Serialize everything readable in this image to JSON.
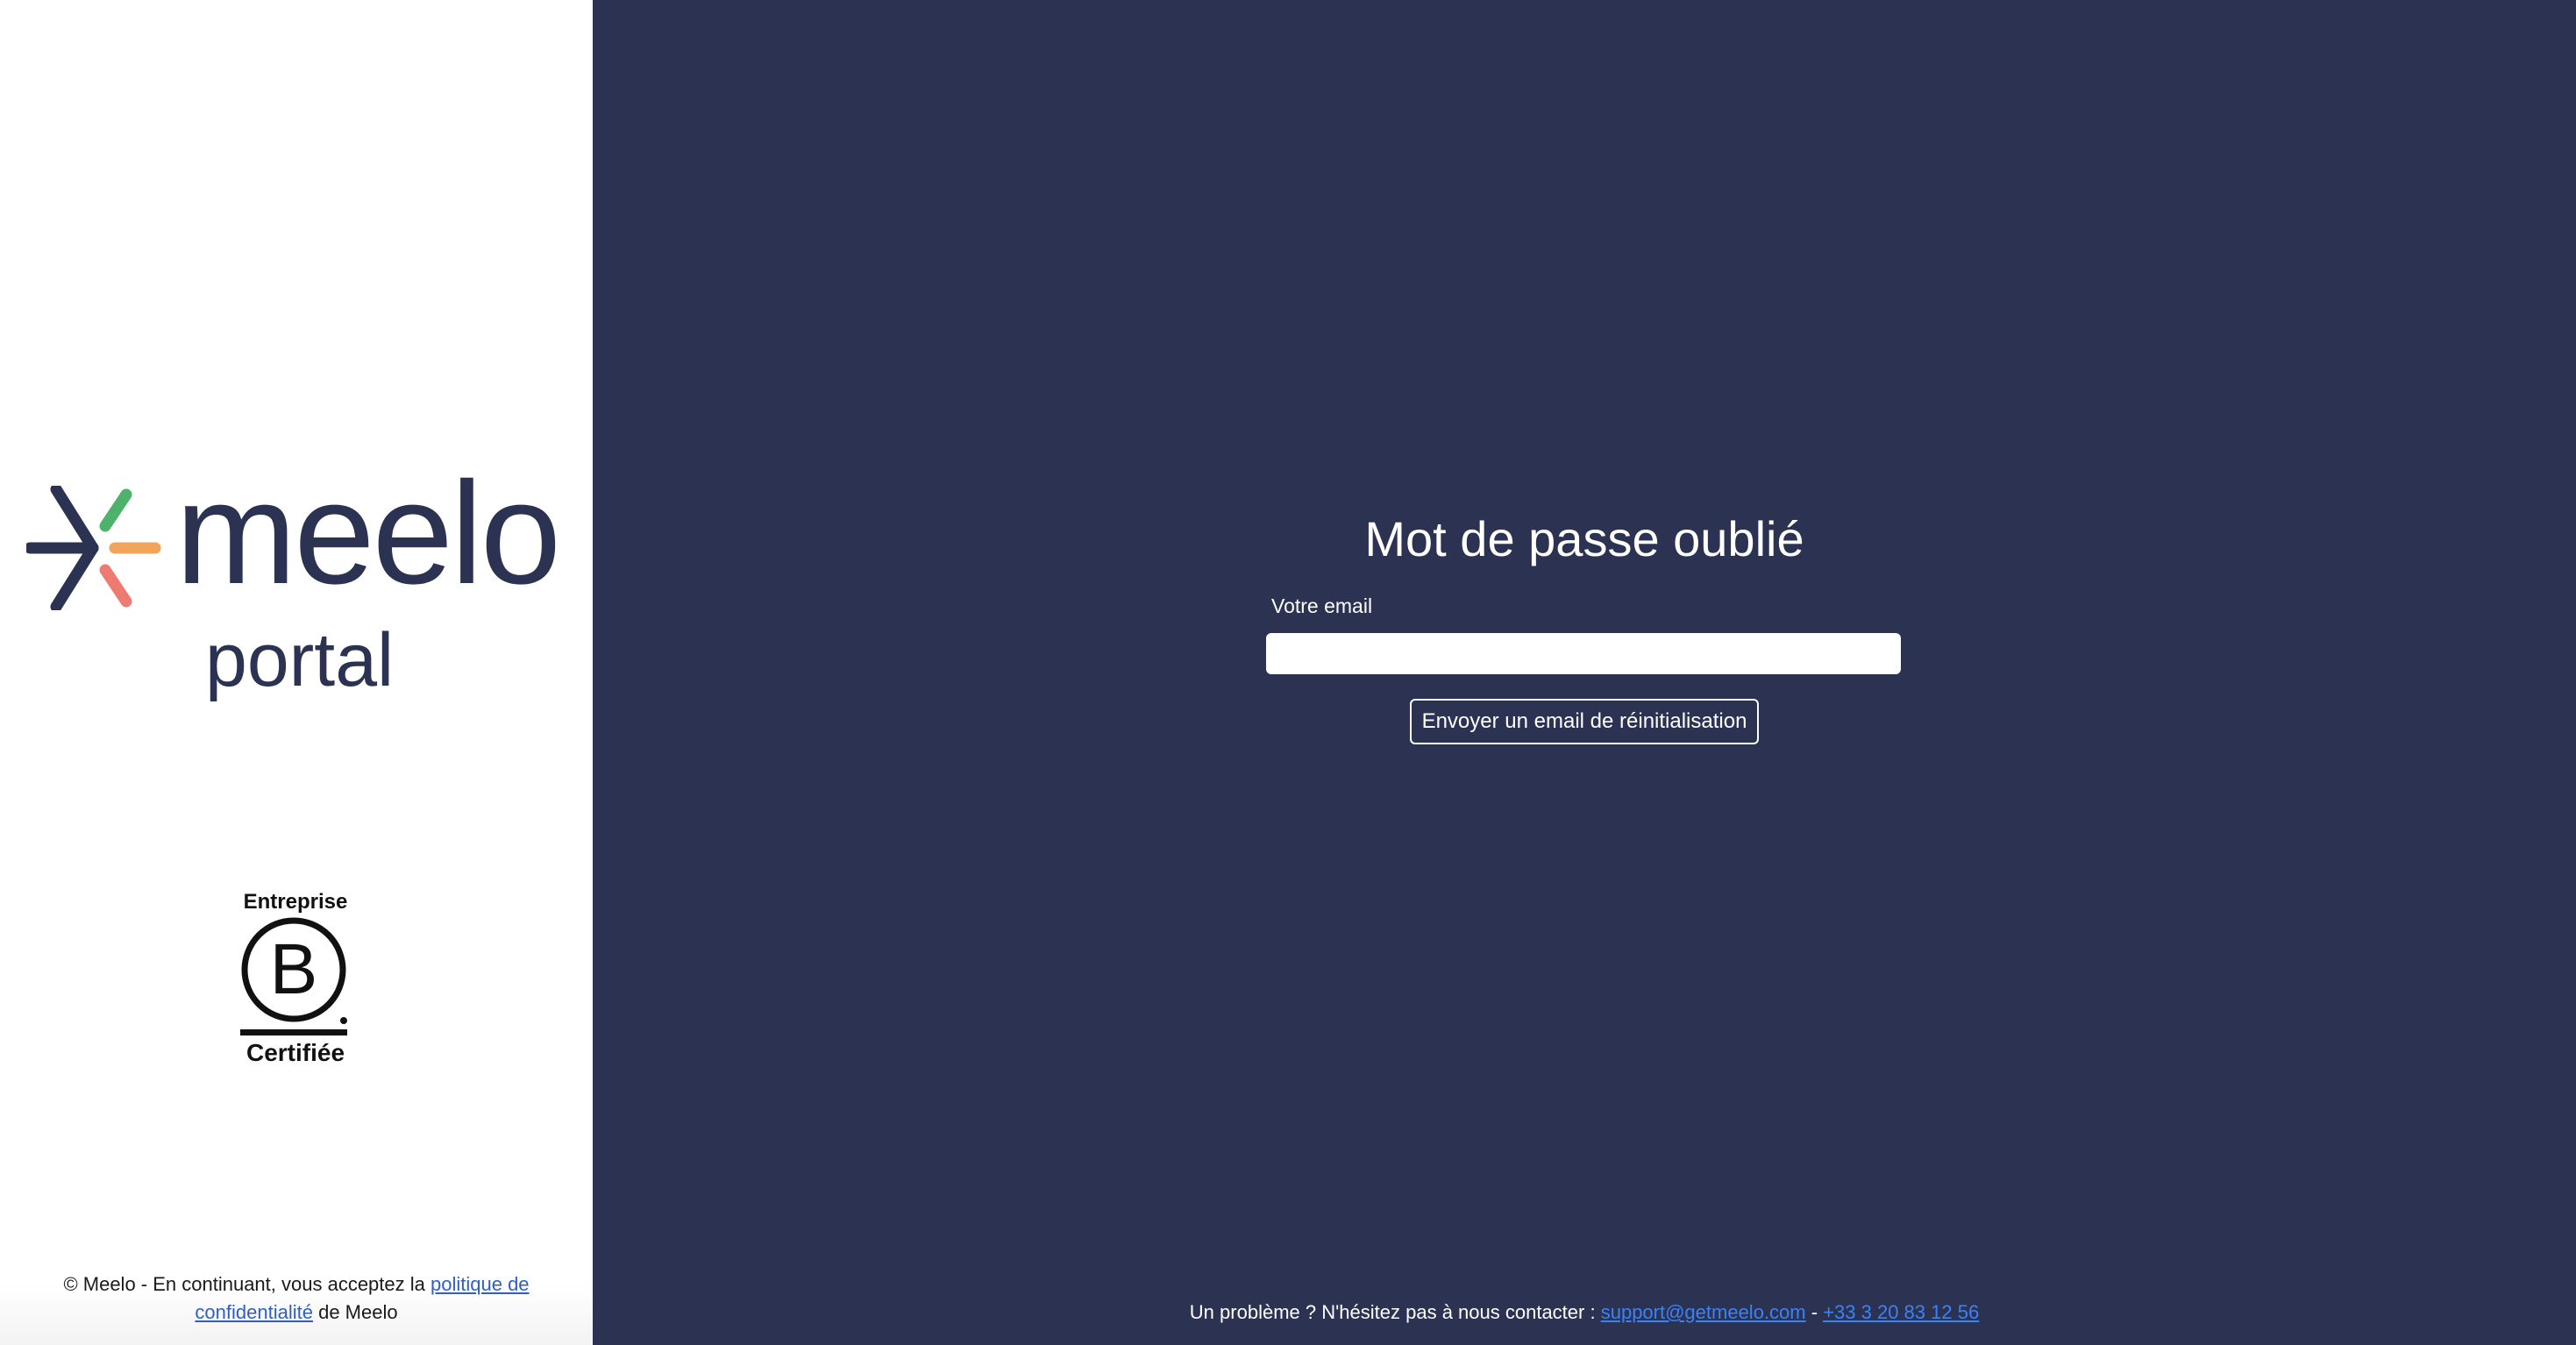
{
  "brand": {
    "name": "meelo",
    "subtitle": "portal",
    "mark_colors": {
      "navy": "#2c3352",
      "green": "#4db36c",
      "orange": "#f0a55a",
      "red": "#ee7b72"
    }
  },
  "certification": {
    "top_text": "Entreprise",
    "letter": "B",
    "bottom_text": "Certifiée"
  },
  "legal_footer": {
    "prefix": "© Meelo - En continuant, vous acceptez la",
    "link_text": "politique de confidentialité",
    "suffix": "de Meelo"
  },
  "form": {
    "title": "Mot de passe oublié",
    "email_label": "Votre email",
    "email_value": "",
    "email_placeholder": "",
    "submit_label": "Envoyer un email de réinitialisation"
  },
  "contact_footer": {
    "text": "Un problème ? N'hésitez pas à nous contacter :",
    "email": "support@getmeelo.com",
    "separator": "-",
    "phone": "+33 3 20 83 12 56"
  },
  "colors": {
    "panel_background": "#2c3352",
    "link": "#3b82f6",
    "legal_link": "#2f5ec8"
  }
}
